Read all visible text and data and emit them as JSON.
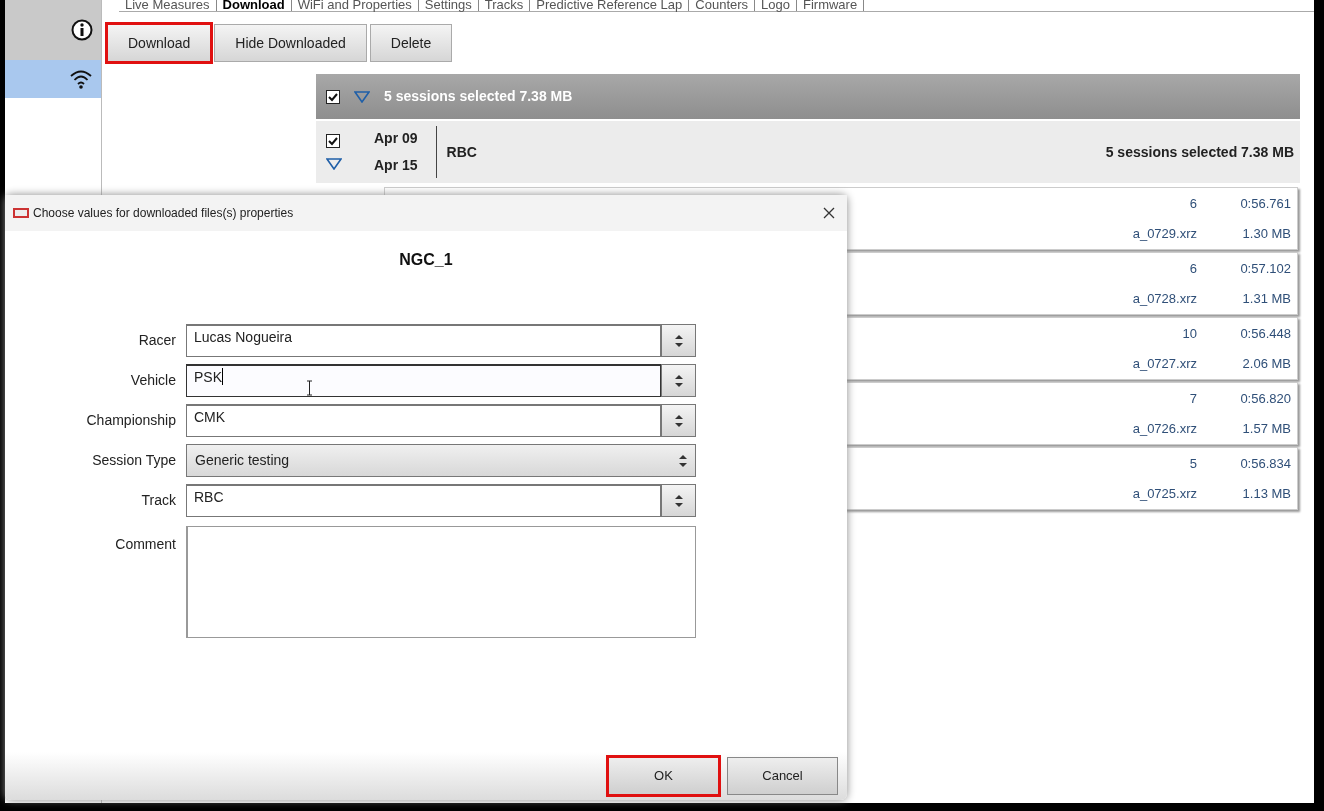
{
  "tabs": [
    {
      "label": "Live Measures",
      "selected": false
    },
    {
      "label": "Download",
      "selected": true
    },
    {
      "label": "WiFi and Properties",
      "selected": false
    },
    {
      "label": "Settings",
      "selected": false
    },
    {
      "label": "Tracks",
      "selected": false
    },
    {
      "label": "Predictive Reference Lap",
      "selected": false
    },
    {
      "label": "Counters",
      "selected": false
    },
    {
      "label": "Logo",
      "selected": false
    },
    {
      "label": "Firmware",
      "selected": false
    }
  ],
  "sidebar": {
    "items": [
      {
        "kind": "info",
        "selected": false
      },
      {
        "kind": "wifi",
        "selected": true
      }
    ]
  },
  "toolbar": [
    {
      "label": "Download",
      "highlighted": true
    },
    {
      "label": "Hide Downloaded",
      "highlighted": false
    },
    {
      "label": "Delete",
      "highlighted": false
    }
  ],
  "sessions_header": {
    "checked": true,
    "expanded": true,
    "summary": "5 sessions selected 7.38 MB"
  },
  "group": {
    "checked": true,
    "expanded": true,
    "date_from": "Apr 09",
    "date_to": "Apr 15",
    "track": "RBC",
    "summary": "5 sessions selected 7.38 MB"
  },
  "sessions": [
    {
      "laps": "6",
      "best_time": "0:56.761",
      "file": "a_0729.xrz",
      "size": "1.30 MB"
    },
    {
      "laps": "6",
      "best_time": "0:57.102",
      "file": "a_0728.xrz",
      "size": "1.31 MB"
    },
    {
      "laps": "10",
      "best_time": "0:56.448",
      "file": "a_0727.xrz",
      "size": "2.06 MB"
    },
    {
      "laps": "7",
      "best_time": "0:56.820",
      "file": "a_0726.xrz",
      "size": "1.57 MB"
    },
    {
      "laps": "5",
      "best_time": "0:56.834",
      "file": "a_0725.xrz",
      "size": "1.13 MB"
    }
  ],
  "dialog": {
    "title": "Choose values for downloaded files(s) properties",
    "heading": "NGC_1",
    "fields": [
      {
        "label": "Racer",
        "kind": "combo",
        "value": "Lucas Nogueira",
        "focused": false
      },
      {
        "label": "Vehicle",
        "kind": "combo",
        "value": "PSK",
        "focused": true
      },
      {
        "label": "Championship",
        "kind": "combo",
        "value": "CMK",
        "focused": false
      },
      {
        "label": "Session Type",
        "kind": "select",
        "value": "Generic testing",
        "focused": false
      },
      {
        "label": "Track",
        "kind": "combo",
        "value": "RBC",
        "focused": false
      }
    ],
    "comment": {
      "label": "Comment"
    },
    "buttons": [
      {
        "label": "OK",
        "highlighted": true
      },
      {
        "label": "Cancel",
        "highlighted": false
      }
    ]
  }
}
